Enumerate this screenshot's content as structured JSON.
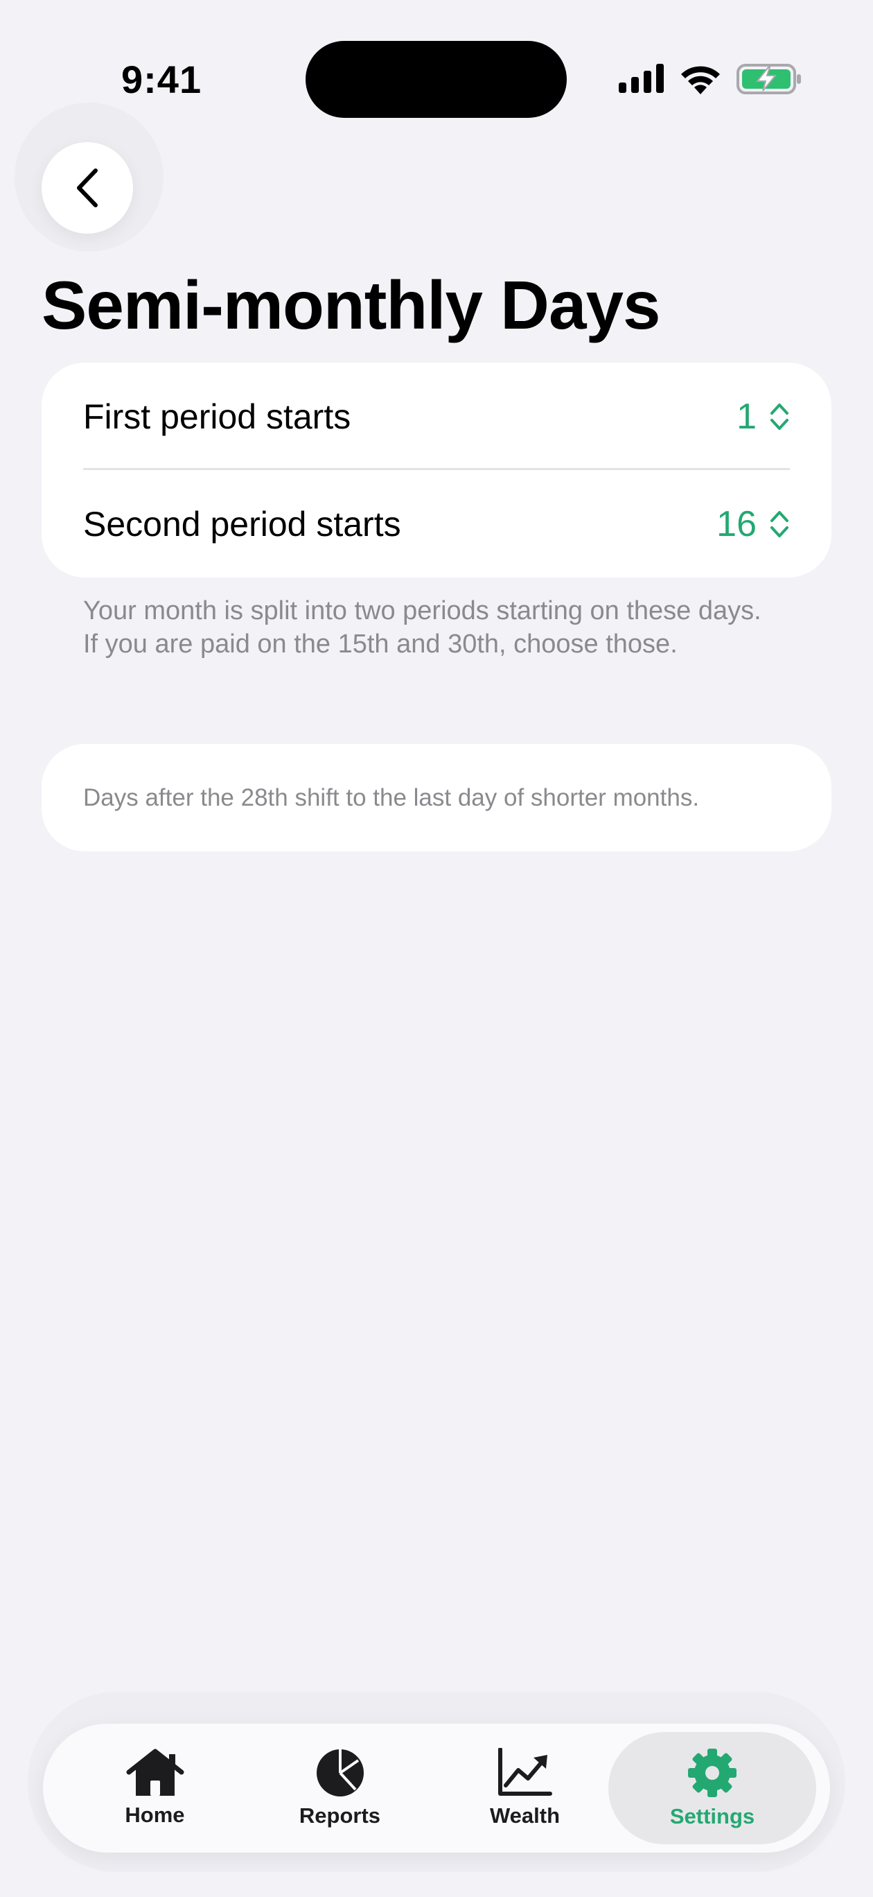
{
  "status_bar": {
    "time": "9:41",
    "icons": [
      "cellular-signal-icon",
      "wifi-icon",
      "battery-charging-icon"
    ]
  },
  "nav": {
    "back_icon": "chevron-left-icon"
  },
  "page": {
    "title": "Semi-monthly Days"
  },
  "periods": {
    "first": {
      "label": "First period starts",
      "value": "1"
    },
    "second": {
      "label": "Second period starts",
      "value": "16"
    },
    "footnote": "Your month is split into two periods starting on these days. If you are paid on the 15th and 30th, choose those."
  },
  "note": {
    "text": "Days after the 28th shift to the last day of shorter months."
  },
  "tab_bar": {
    "tabs": [
      {
        "label": "Home",
        "icon": "house-icon",
        "active": false
      },
      {
        "label": "Reports",
        "icon": "pie-chart-icon",
        "active": false
      },
      {
        "label": "Wealth",
        "icon": "chart-line-uptrend-icon",
        "active": false
      },
      {
        "label": "Settings",
        "icon": "gear-icon",
        "active": true
      }
    ]
  },
  "colors": {
    "accent": "#23a872",
    "background": "#f2f2f7",
    "secondary_text": "#8a8a8e"
  }
}
